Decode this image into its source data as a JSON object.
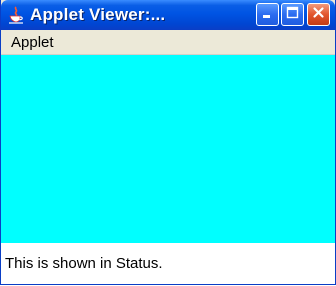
{
  "window": {
    "title": "Applet Viewer:...",
    "icons": {
      "app": "java-cup-icon",
      "minimize": "minimize-icon",
      "maximize": "maximize-icon",
      "close": "close-icon"
    }
  },
  "menubar": {
    "items": [
      {
        "label": "Applet"
      }
    ]
  },
  "applet": {
    "background": "#00ffff"
  },
  "status": {
    "text": "This is shown in Status."
  }
}
